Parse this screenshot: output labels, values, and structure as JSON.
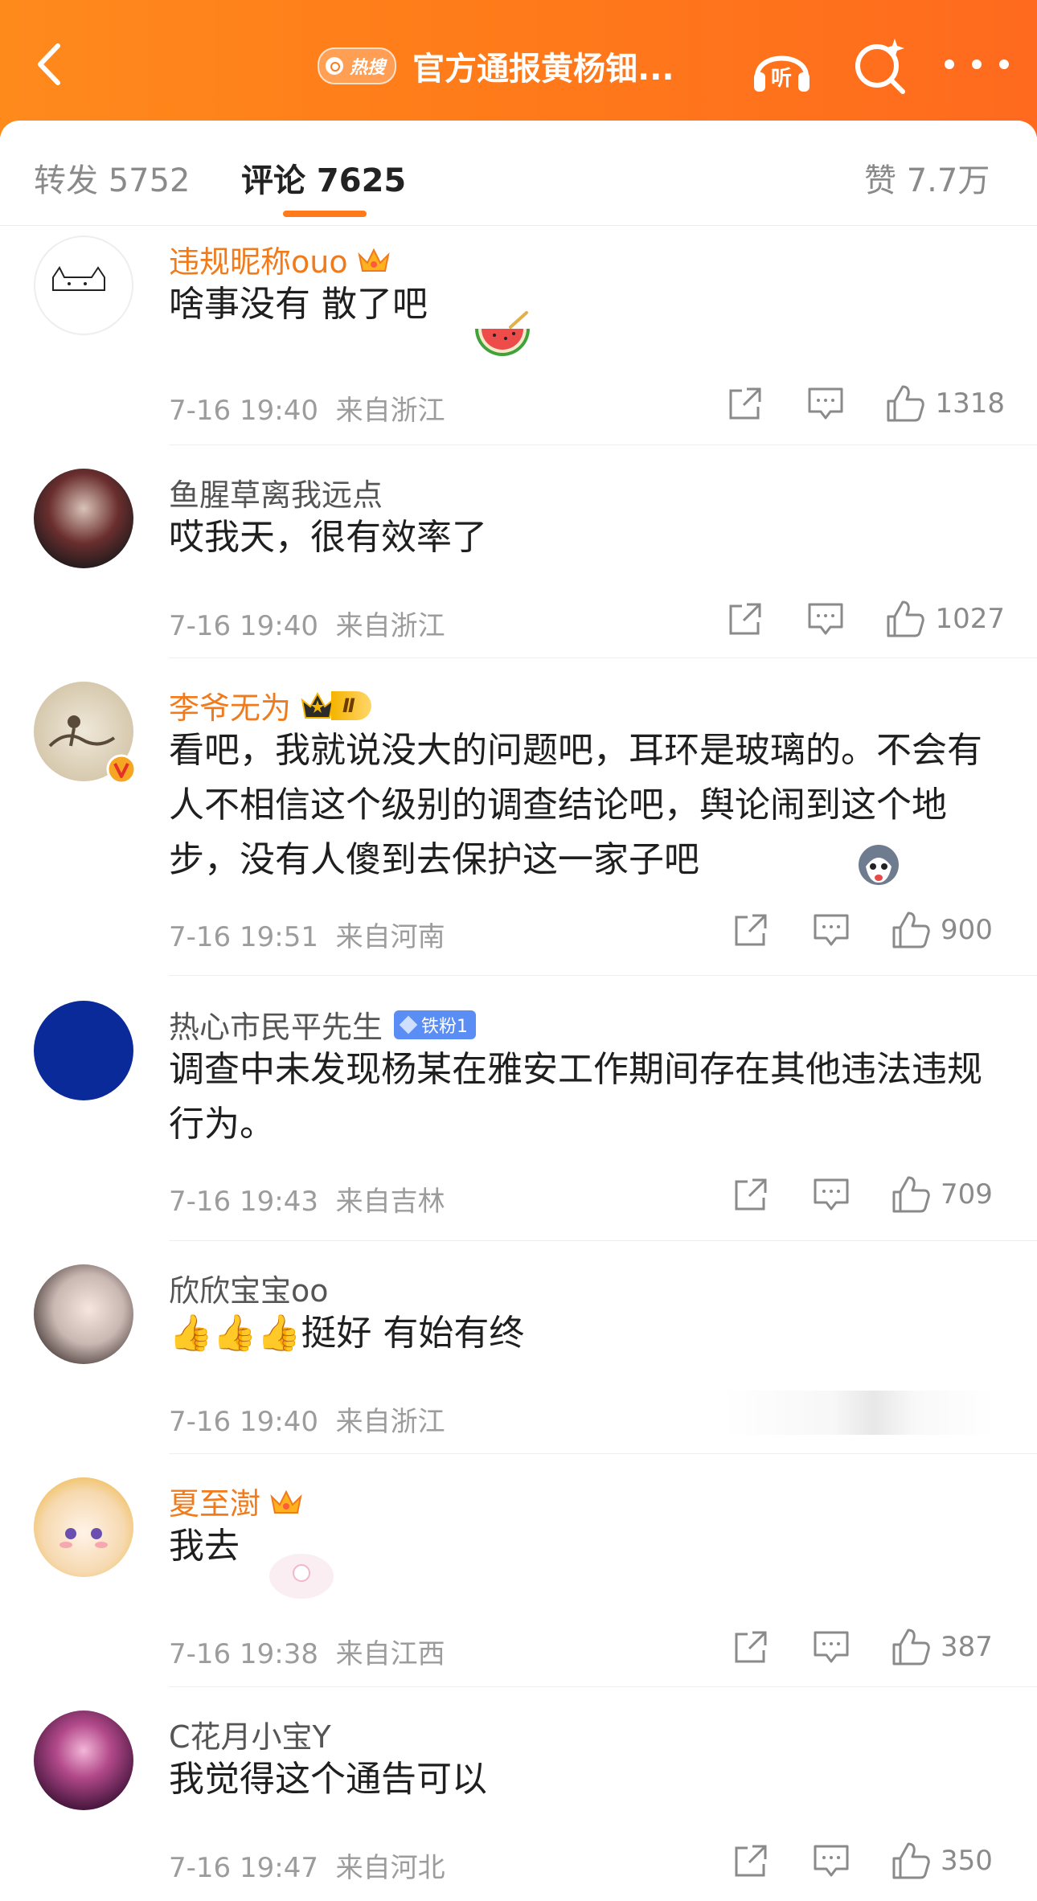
{
  "header": {
    "hot_badge": "热搜",
    "title": "官方通报黄杨钿...",
    "icons": {
      "back": "back-arrow-icon",
      "listen": "headphones-icon",
      "search": "sparkle-search-icon",
      "more": "more-dots-icon"
    }
  },
  "tabs": {
    "repost": "转发 5752",
    "comments": "评论 7625",
    "likes": "赞 7.7万"
  },
  "comments": [
    {
      "nickname": "违规昵称ouo",
      "text": "啥事没有 散了吧",
      "sticker": "watermelon-icon",
      "time": "7-16 19:40",
      "location": "来自浙江",
      "likes": "1318"
    },
    {
      "nickname": "鱼腥草离我远点",
      "text": "哎我天，很有效率了",
      "time": "7-16 19:40",
      "location": "来自浙江",
      "likes": "1027"
    },
    {
      "nickname": "李爷无为",
      "badge_level": "Ⅱ",
      "text": "看吧，我就说没大的问题吧，耳环是玻璃的。不会有人不相信这个级别的调查结论吧，舆论闹到这个地步，没有人傻到去保护这一家子吧",
      "time": "7-16 19:51",
      "location": "来自河南",
      "likes": "900"
    },
    {
      "nickname": "热心市民平先生",
      "fan_badge": "铁粉1",
      "text": "调查中未发现杨某在雅安工作期间存在其他违法违规行为。",
      "time": "7-16 19:43",
      "location": "来自吉林",
      "likes": "709"
    },
    {
      "nickname": "欣欣宝宝oo",
      "text": "👍👍👍挺好 有始有终",
      "time": "7-16 19:40",
      "location": "来自浙江",
      "likes": ""
    },
    {
      "nickname": "夏至澍",
      "text": "我去",
      "time": "7-16 19:38",
      "location": "来自江西",
      "likes": "387"
    },
    {
      "nickname": "C花月小宝Y",
      "text": "我觉得这个通告可以",
      "time": "7-16 19:47",
      "location": "来自河北",
      "likes": "350"
    }
  ],
  "colors": {
    "header_orange": "#ff7a1a",
    "vip_name": "#f07b1d",
    "meta_grey": "#9c9c9c"
  }
}
